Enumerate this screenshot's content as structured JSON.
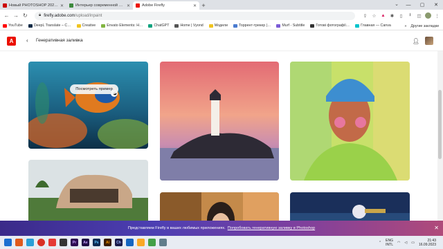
{
  "browser": {
    "tabs": [
      {
        "title": "Новый PHOTOSHOP 2024 | Отве",
        "favicon_color": "#cc0000",
        "active": false
      },
      {
        "title": "Интерьер современной фотос",
        "favicon_color": "#3d8a3d",
        "active": false
      },
      {
        "title": "Adobe Firefly",
        "favicon_color": "#eb1000",
        "active": true
      }
    ],
    "new_tab_icon": "plus-icon",
    "address": {
      "domain": "firefly.adobe.com",
      "path": "/upload/inpaint",
      "full": "firefly.adobe.com/upload/inpaint"
    },
    "bookmarks": [
      {
        "label": "YouTube",
        "color": "#ff0000"
      },
      {
        "label": "DeepL Translate – C…",
        "color": "#0f2b46"
      },
      {
        "label": "Creative",
        "color": "#f0c420"
      },
      {
        "label": "Envato Elements: H…",
        "color": "#82b541"
      },
      {
        "label": "ChatGPT",
        "color": "#10a37f"
      },
      {
        "label": "Home | Vyond",
        "color": "#555555"
      },
      {
        "label": "Модели",
        "color": "#f0c420"
      },
      {
        "label": "Торрент-трекер |…",
        "color": "#4a7bd0"
      },
      {
        "label": "Murf - Subtitle",
        "color": "#7b5bd6"
      },
      {
        "label": "Готові фотографії…",
        "color": "#333333"
      },
      {
        "label": "Главная — Canva",
        "color": "#00c4cc"
      }
    ],
    "other_bookmarks": "Другие закладки"
  },
  "app": {
    "logo_letter": "A",
    "title": "Генеративная заливка",
    "view_example": "Посмотреть пример"
  },
  "promo": {
    "text": "Представляем Firefly в ваших любимых приложениях.",
    "link": "Попробовать генеративную заливку в Photoshop"
  },
  "taskbar": {
    "lang_top": "ENG",
    "lang_bottom": "INTL",
    "time": "21:43",
    "date": "16.09.2023",
    "apps": [
      {
        "label": "",
        "color": "#1a6fd1"
      },
      {
        "label": "",
        "color": "#e05a1c"
      },
      {
        "label": "",
        "color": "#2a9fd6"
      },
      {
        "label": "",
        "color": "#d93025"
      },
      {
        "label": "",
        "color": "#e53935"
      },
      {
        "label": "",
        "color": "#333333"
      },
      {
        "label": "Pr",
        "color": "#2d0a52"
      },
      {
        "label": "Ae",
        "color": "#1f0b45"
      },
      {
        "label": "Ps",
        "color": "#0a2a52"
      },
      {
        "label": "Ai",
        "color": "#3a1d00"
      },
      {
        "label": "Ch",
        "color": "#1a1a4a"
      },
      {
        "label": "",
        "color": "#1565c0"
      },
      {
        "label": "",
        "color": "#f9a825"
      },
      {
        "label": "",
        "color": "#43a047"
      },
      {
        "label": "",
        "color": "#607d8b"
      }
    ]
  }
}
